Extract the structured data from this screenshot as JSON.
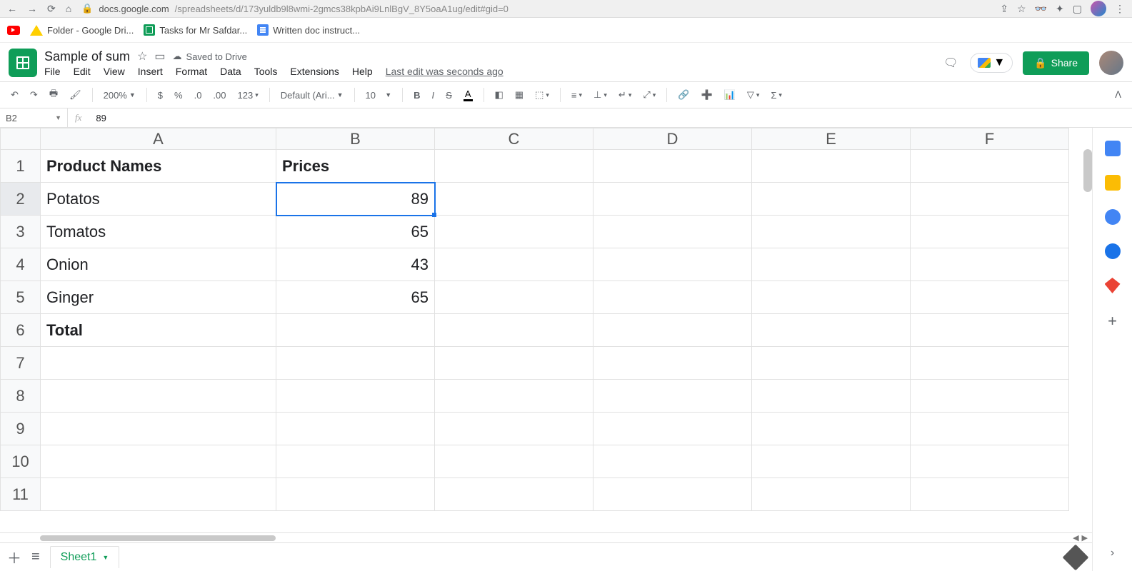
{
  "browser": {
    "url_host": "docs.google.com",
    "url_path": "/spreadsheets/d/173yuldb9l8wmi-2gmcs38kpbAi9LnlBgV_8Y5oaA1ug/edit#gid=0"
  },
  "bookmarks": [
    {
      "label": "Folder - Google Dri..."
    },
    {
      "label": "Tasks for Mr Safdar..."
    },
    {
      "label": "Written doc instruct..."
    }
  ],
  "doc": {
    "title": "Sample of sum",
    "saved": "Saved to Drive",
    "last_edit": "Last edit was seconds ago",
    "menus": [
      "File",
      "Edit",
      "View",
      "Insert",
      "Format",
      "Data",
      "Tools",
      "Extensions",
      "Help"
    ],
    "share": "Share"
  },
  "toolbar": {
    "zoom": "200%",
    "font": "Default (Ari...",
    "font_size": "10",
    "decimal_less": ".0",
    "decimal_more": ".00",
    "num_format": "123"
  },
  "formula": {
    "name_box": "B2",
    "fx": "fx",
    "value": "89"
  },
  "columns": [
    "A",
    "B",
    "C",
    "D",
    "E",
    "F"
  ],
  "rows": [
    "1",
    "2",
    "3",
    "4",
    "5",
    "6",
    "7",
    "8",
    "9",
    "10",
    "11"
  ],
  "selected_cell": "B2",
  "cells": {
    "A1": {
      "v": "Product Names",
      "bold": true
    },
    "B1": {
      "v": "Prices",
      "bold": true
    },
    "A2": {
      "v": "Potatos"
    },
    "B2": {
      "v": "89",
      "num": true,
      "selected": true
    },
    "A3": {
      "v": "Tomatos"
    },
    "B3": {
      "v": "65",
      "num": true
    },
    "A4": {
      "v": "Onion"
    },
    "B4": {
      "v": "43",
      "num": true
    },
    "A5": {
      "v": "Ginger"
    },
    "B5": {
      "v": "65",
      "num": true
    },
    "A6": {
      "v": "Total",
      "bold": true
    }
  },
  "sheet_tab": "Sheet1"
}
